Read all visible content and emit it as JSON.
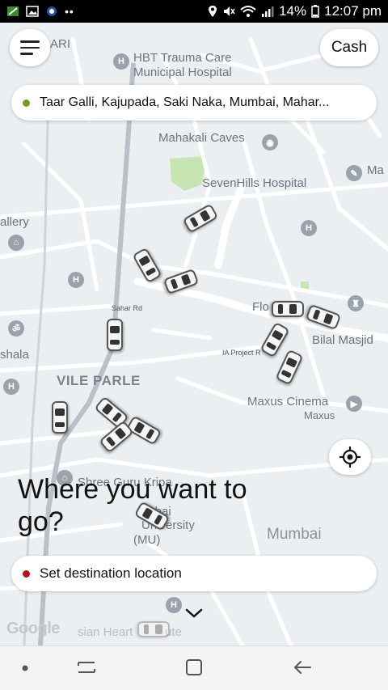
{
  "status_bar": {
    "battery": "14%",
    "time": "12:07 pm",
    "icons": [
      "notification-icon",
      "gallery-icon",
      "app-icon",
      "more-dots-icon",
      "location-icon",
      "mute-icon",
      "wifi-icon",
      "signal-icon",
      "battery-icon"
    ]
  },
  "header": {
    "menu_icon": "hamburger-icon",
    "payment_label": "Cash"
  },
  "pickup": {
    "dot_color": "#6aa121",
    "address": "Taar Galli, Kajupada, Saki Naka, Mumbai, Mahar..."
  },
  "map": {
    "labels": {
      "ari": "ARI",
      "hbt_hospital_line1": "HBT Trauma Care",
      "hbt_hospital_line2": "Municipal Hospital",
      "mahakali_caves": "Mahakali Caves",
      "ma": "Ma",
      "sevenhills": "SevenHills Hospital",
      "gallery": "allery",
      "sahar_rd": "Sahar Rd",
      "flo_fountain": "Flo  F  tain",
      "bilal_masjid": "Bilal Masjid",
      "ia_project_rd": "IA Project R",
      "shala": "shala",
      "vile_parle": "VILE PARLE",
      "maxus_cinema": "Maxus Cinema",
      "maxus": "Maxus",
      "shree_guru_kripa": "Shree Guru Kripa",
      "mumbai_univ_line1": "M    bai",
      "mumbai_univ_line2": "University",
      "mumbai_univ_line3": "(MU)",
      "mumbai": "Mumbai",
      "asian_heart": "sian Heart",
      "ute": "ute",
      "google": "Google"
    }
  },
  "prompt": {
    "text": "Where you want to go?"
  },
  "destination": {
    "dot_color": "#b3121a",
    "placeholder": "Set destination location"
  },
  "controls": {
    "locate_icon": "my-location-icon",
    "expand_icon": "chevron-down-icon"
  },
  "nav_bar": {
    "items": [
      "dot-icon",
      "recent-apps-icon",
      "home-icon",
      "back-icon"
    ]
  }
}
